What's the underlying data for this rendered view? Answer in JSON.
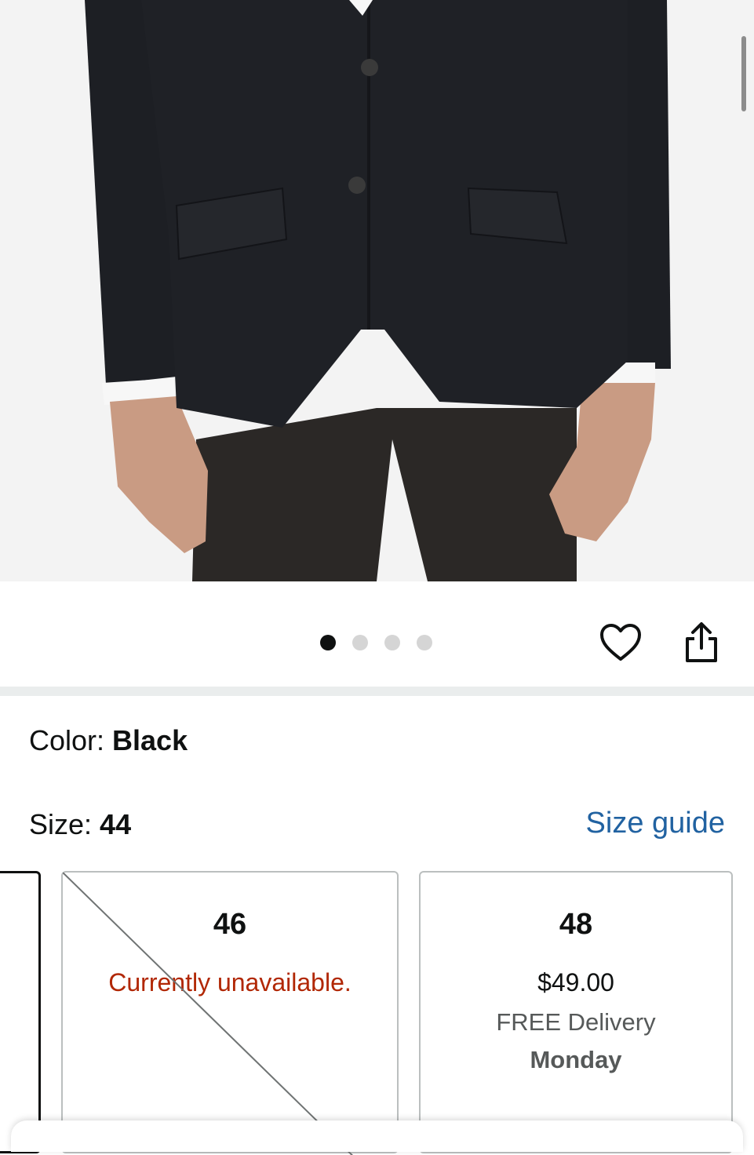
{
  "product_image": {
    "icon": "product-photo-blazer"
  },
  "carousel": {
    "total": 4,
    "active_index": 0
  },
  "actions": {
    "wishlist_icon": "heart-icon",
    "share_icon": "share-icon"
  },
  "color": {
    "label": "Color: ",
    "value": "Black"
  },
  "size": {
    "label": "Size: ",
    "value": "44",
    "guide_link": "Size guide"
  },
  "size_options": [
    {
      "size": "46",
      "status": "Currently unavailable."
    },
    {
      "size": "48",
      "price": "$49.00",
      "delivery": "FREE Delivery",
      "day": "Monday"
    }
  ],
  "colors": {
    "link": "#2162a1",
    "unavailable": "#b12704",
    "muted": "#565959"
  }
}
